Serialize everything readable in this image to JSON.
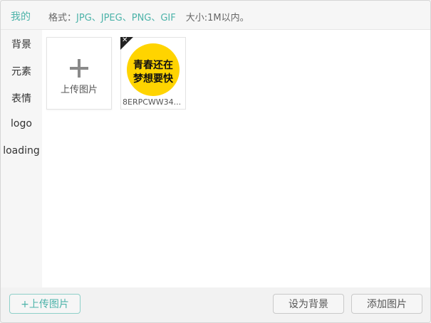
{
  "tabs": {
    "mine": "我的"
  },
  "format": {
    "label": "格式：",
    "types": "JPG、JPEG、PNG、GIF",
    "size": "大小:1M以内。"
  },
  "sidebar": {
    "items": [
      {
        "label": "背景"
      },
      {
        "label": "元素"
      },
      {
        "label": "表情"
      },
      {
        "label": "logo"
      },
      {
        "label": "loading"
      }
    ]
  },
  "grid": {
    "upload_tile_label": "上传图片",
    "items": [
      {
        "image_text_line1": "青春还在",
        "image_text_line2": "梦想要快",
        "name": "8ERPCWW34...",
        "delete_icon": "close-icon"
      }
    ]
  },
  "footer": {
    "upload_button": "+上传图片",
    "set_background_button": "设为背景",
    "add_image_button": "添加图片"
  },
  "colors": {
    "accent": "#4cb3a9",
    "thumb_bg": "#ffd400"
  }
}
